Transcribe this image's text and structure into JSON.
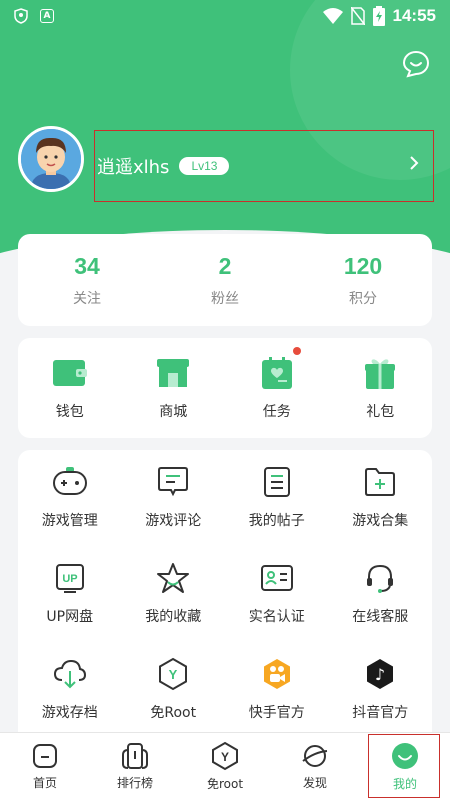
{
  "status_bar": {
    "time": "14:55",
    "left_icons": [
      "shield-icon",
      "a-icon"
    ],
    "right_icons": [
      "wifi-icon",
      "no-sim-icon",
      "battery-charging-icon"
    ],
    "a_glyph": "A"
  },
  "colors": {
    "accent": "#3fc17a",
    "alert": "#e74c3c",
    "highlight_frame": "#c9302c"
  },
  "profile": {
    "username": "逍遥xlhs",
    "level": "Lv13"
  },
  "stats": [
    {
      "value": "34",
      "label": "关注"
    },
    {
      "value": "2",
      "label": "粉丝"
    },
    {
      "value": "120",
      "label": "积分"
    }
  ],
  "wallet_row": [
    {
      "label": "钱包",
      "icon": "wallet-icon"
    },
    {
      "label": "商城",
      "icon": "store-icon"
    },
    {
      "label": "任务",
      "icon": "task-icon",
      "has_badge": true
    },
    {
      "label": "礼包",
      "icon": "gift-icon"
    }
  ],
  "services": [
    {
      "label": "游戏管理",
      "icon": "gamepad-icon"
    },
    {
      "label": "游戏评论",
      "icon": "comment-icon"
    },
    {
      "label": "我的帖子",
      "icon": "post-icon"
    },
    {
      "label": "游戏合集",
      "icon": "folder-add-icon"
    },
    {
      "label": "UP网盘",
      "icon": "up-disk-icon",
      "glyph": "UP"
    },
    {
      "label": "我的收藏",
      "icon": "star-icon"
    },
    {
      "label": "实名认证",
      "icon": "id-card-icon"
    },
    {
      "label": "在线客服",
      "icon": "headset-icon"
    },
    {
      "label": "游戏存档",
      "icon": "cloud-download-icon"
    },
    {
      "label": "免Root",
      "icon": "hexagon-y-icon",
      "glyph": "Y"
    },
    {
      "label": "快手官方",
      "icon": "kuaishou-icon"
    },
    {
      "label": "抖音官方",
      "icon": "douyin-icon",
      "glyph": "♪"
    }
  ],
  "tabs": [
    {
      "label": "首页",
      "icon": "home-icon"
    },
    {
      "label": "排行榜",
      "icon": "ranking-icon"
    },
    {
      "label": "免root",
      "icon": "hexagon-y-icon",
      "glyph": "Y"
    },
    {
      "label": "发现",
      "icon": "planet-icon"
    },
    {
      "label": "我的",
      "icon": "smile-icon",
      "active": true
    }
  ]
}
